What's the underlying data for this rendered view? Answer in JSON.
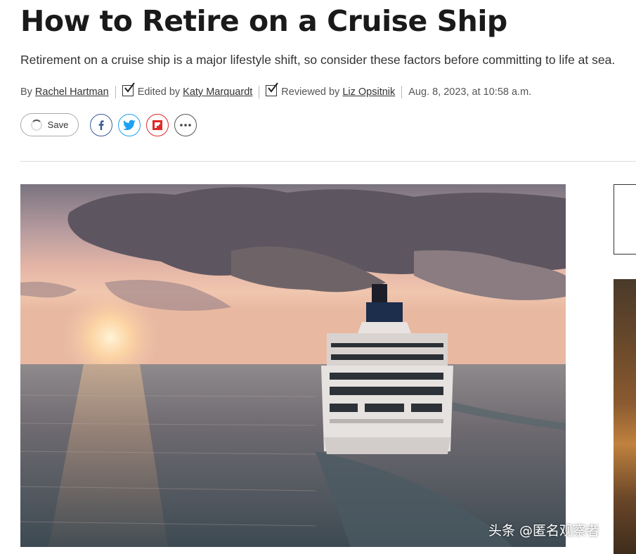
{
  "article": {
    "title": "How to Retire on a Cruise Ship",
    "dek": "Retirement on a cruise ship is a major lifestyle shift, so consider these factors before committing to life at sea.",
    "byline": {
      "by_prefix": "By",
      "author": "Rachel Hartman",
      "edited_prefix": "Edited by",
      "editor": "Katy Marquardt",
      "reviewed_prefix": "Reviewed by",
      "reviewer": "Liz Opsitnik",
      "date": "Aug. 8, 2023, at 10:58 a.m."
    }
  },
  "actions": {
    "save_label": "Save",
    "share": [
      {
        "icon": "facebook-icon",
        "color": "#3b5998"
      },
      {
        "icon": "twitter-icon",
        "color": "#1da1f2"
      },
      {
        "icon": "flipboard-icon",
        "color": "#e12828"
      },
      {
        "icon": "more-icon",
        "color": "#555555"
      }
    ]
  },
  "watermark": "头条 @匿名观察者"
}
